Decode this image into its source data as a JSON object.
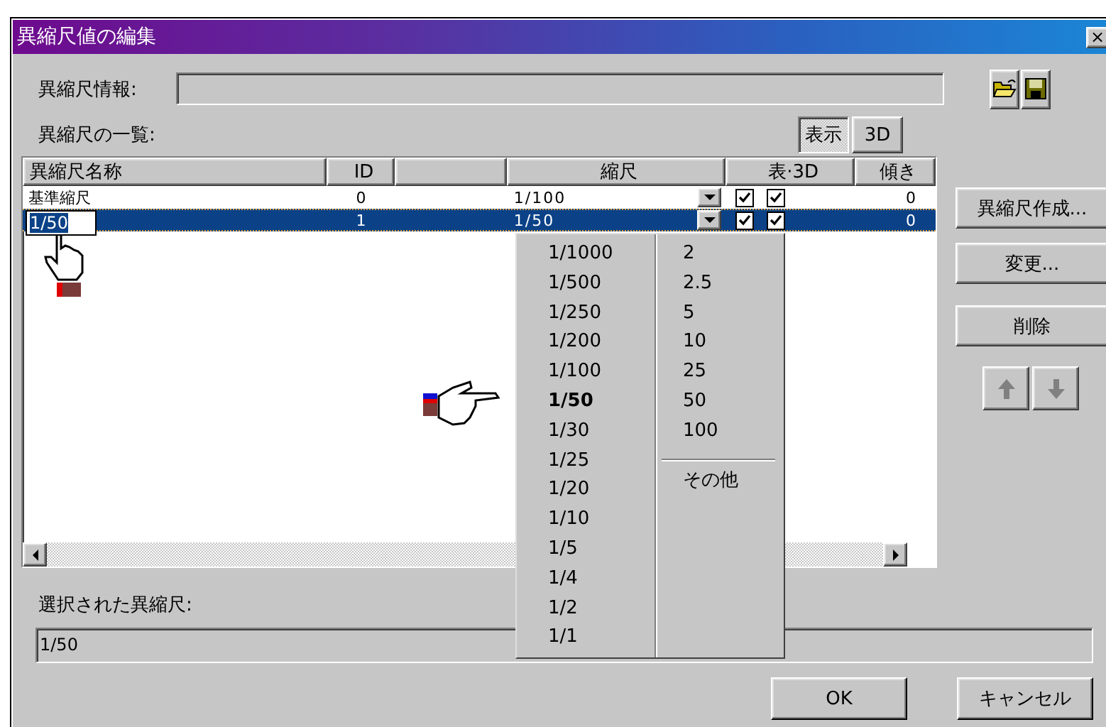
{
  "window": {
    "title": "異縮尺値の編集",
    "close": "×"
  },
  "info": {
    "label": "異縮尺情報:"
  },
  "list_label": "異縮尺の一覧:",
  "view_toggles": [
    {
      "label": "表示",
      "selected": true
    },
    {
      "label": "3D",
      "selected": false
    }
  ],
  "table": {
    "columns": [
      "異縮尺名称",
      "ID",
      "縮尺",
      "表·3D",
      "傾き"
    ],
    "rows": [
      {
        "name": "基準縮尺",
        "id": "0",
        "scale": "1/100",
        "show": true,
        "three_d": true,
        "tilt": "0",
        "selected": false,
        "editing": false
      },
      {
        "name": "1/50",
        "id": "1",
        "scale": "1/50",
        "show": true,
        "three_d": true,
        "tilt": "0",
        "selected": true,
        "editing": true
      }
    ]
  },
  "scale_dropdown": {
    "fractions": [
      {
        "label": "1/1000",
        "selected": false
      },
      {
        "label": "1/500",
        "selected": false
      },
      {
        "label": "1/250",
        "selected": false
      },
      {
        "label": "1/200",
        "selected": false
      },
      {
        "label": "1/100",
        "selected": false
      },
      {
        "label": "1/50",
        "selected": true
      },
      {
        "label": "1/30",
        "selected": false
      },
      {
        "label": "1/25",
        "selected": false
      },
      {
        "label": "1/20",
        "selected": false
      },
      {
        "label": "1/10",
        "selected": false
      },
      {
        "label": "1/5",
        "selected": false
      },
      {
        "label": "1/4",
        "selected": false
      },
      {
        "label": "1/2",
        "selected": false
      },
      {
        "label": "1/1",
        "selected": false
      }
    ],
    "multipliers": [
      "2",
      "2.5",
      "5",
      "10",
      "25",
      "50",
      "100"
    ],
    "other": "その他"
  },
  "side_buttons": [
    "異縮尺作成...",
    "変更...",
    "削除"
  ],
  "move_buttons": [
    {
      "kind": "up",
      "disabled": true
    },
    {
      "kind": "down",
      "disabled": true
    }
  ],
  "selected_label": "選択された異縮尺:",
  "selected_value": "1/50",
  "buttons": [
    "OK",
    "キャンセル"
  ]
}
